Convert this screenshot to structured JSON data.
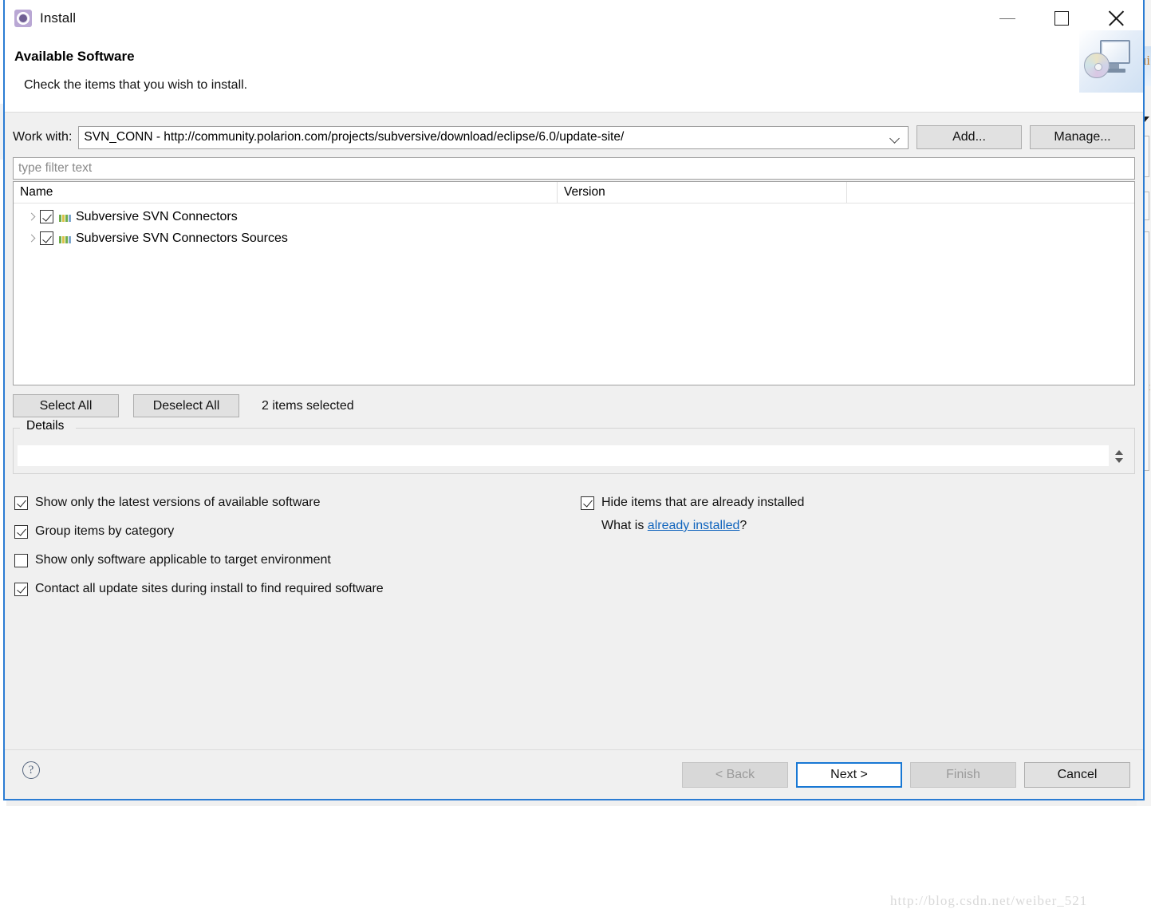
{
  "window": {
    "title": "Install",
    "icon": "install-gear-icon",
    "minimize_label": "Minimize",
    "maximize_label": "Maximize",
    "close_label": "Close"
  },
  "header": {
    "title": "Available Software",
    "subtitle": "Check the items that you wish to install.",
    "graphic": "monitor-with-cd-icon"
  },
  "work_with": {
    "label": "Work with:",
    "value": "SVN_CONN - http://community.polarion.com/projects/subversive/download/eclipse/6.0/update-site/",
    "dropdown_icon": "chevron-down-icon",
    "add_button": "Add...",
    "manage_button": "Manage..."
  },
  "filter": {
    "placeholder": "type filter text",
    "value": ""
  },
  "tree": {
    "columns": [
      "Name",
      "Version"
    ],
    "rows": [
      {
        "name": "Subversive SVN Connectors",
        "version": "",
        "checked": true,
        "expandable": true,
        "icon": "category-bars-icon"
      },
      {
        "name": "Subversive SVN Connectors Sources",
        "version": "",
        "checked": true,
        "expandable": true,
        "icon": "category-bars-icon"
      }
    ]
  },
  "selection": {
    "select_all": "Select All",
    "deselect_all": "Deselect All",
    "status": "2 items selected"
  },
  "details": {
    "legend": "Details",
    "content": "",
    "spinner_icon": "spinner-up-down-icon"
  },
  "options": {
    "left": [
      {
        "label": "Show only the latest versions of available software",
        "checked": true
      },
      {
        "label": "Group items by category",
        "checked": true
      },
      {
        "label": "Show only software applicable to target environment",
        "checked": false
      },
      {
        "label": "Contact all update sites during install to find required software",
        "checked": true
      }
    ],
    "right": [
      {
        "label": "Hide items that are already installed",
        "checked": true
      }
    ],
    "what_is_prefix": "What is ",
    "what_is_link": "already installed",
    "what_is_suffix": "?"
  },
  "footer": {
    "help_icon": "help-question-icon",
    "back": "< Back",
    "next": "Next >",
    "finish": "Finish",
    "cancel": "Cancel"
  },
  "watermark": "http://blog.csdn.net/weiber_521",
  "colors": {
    "dialog_border": "#2b7cd3",
    "link": "#1064bd",
    "default_button_border": "#1878d4",
    "panel_bg": "#f0f0f0"
  }
}
